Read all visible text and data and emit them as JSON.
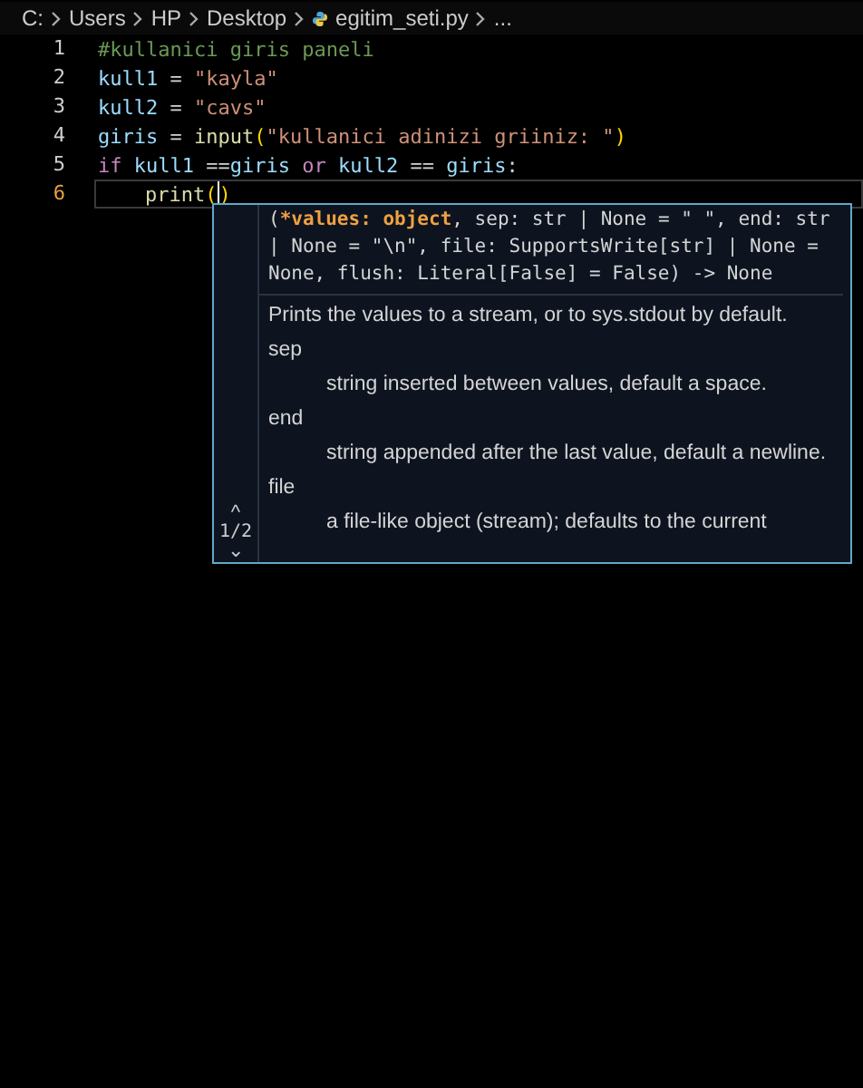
{
  "breadcrumb": [
    {
      "label": "C:",
      "kind": "text"
    },
    {
      "label": "Users",
      "kind": "text"
    },
    {
      "label": "HP",
      "kind": "text"
    },
    {
      "label": "Desktop",
      "kind": "text"
    },
    {
      "label": "egitim_seti.py",
      "kind": "file"
    },
    {
      "label": "...",
      "kind": "text"
    }
  ],
  "editor": {
    "lines": [
      {
        "number": "1",
        "current": false,
        "tokens": [
          {
            "text": "#kullanici giris paneli",
            "kind": "comment"
          }
        ]
      },
      {
        "number": "2",
        "current": false,
        "tokens": [
          {
            "text": "kull1",
            "kind": "variable"
          },
          {
            "text": " = ",
            "kind": "operator"
          },
          {
            "text": "\"kayla\"",
            "kind": "string"
          }
        ]
      },
      {
        "number": "3",
        "current": false,
        "tokens": [
          {
            "text": "kull2",
            "kind": "variable"
          },
          {
            "text": " = ",
            "kind": "operator"
          },
          {
            "text": "\"cavs\"",
            "kind": "string"
          }
        ]
      },
      {
        "number": "4",
        "current": false,
        "tokens": [
          {
            "text": "giris",
            "kind": "variable"
          },
          {
            "text": " = ",
            "kind": "operator"
          },
          {
            "text": "input",
            "kind": "function"
          },
          {
            "text": "(",
            "kind": "bracket"
          },
          {
            "text": "\"kullanici adinizi griiniz: \"",
            "kind": "string"
          },
          {
            "text": ")",
            "kind": "bracket"
          }
        ]
      },
      {
        "number": "5",
        "current": false,
        "tokens": [
          {
            "text": "if",
            "kind": "keyword"
          },
          {
            "text": " kull1",
            "kind": "variable"
          },
          {
            "text": " ==",
            "kind": "operator"
          },
          {
            "text": "giris",
            "kind": "variable"
          },
          {
            "text": " or",
            "kind": "keyword"
          },
          {
            "text": " kull2",
            "kind": "variable"
          },
          {
            "text": " == ",
            "kind": "operator"
          },
          {
            "text": "giris",
            "kind": "variable"
          },
          {
            "text": ":",
            "kind": "operator"
          }
        ]
      },
      {
        "number": "6",
        "current": true,
        "indented": true,
        "tokens": [
          {
            "text": "print",
            "kind": "function"
          },
          {
            "text": "(",
            "kind": "bracket"
          },
          {
            "text": ")",
            "kind": "bracket",
            "cursor_before": true
          }
        ]
      }
    ]
  },
  "signature_help": {
    "signature": [
      {
        "text": "(",
        "active": false
      },
      {
        "text": "*values: object",
        "active": true
      },
      {
        "text": ", sep: str | None = \" \", end: str | None = \"\\n\", file: SupportsWrite[str] | None = None, flush: Literal[False] = False) -> None",
        "active": false
      }
    ],
    "docs": [
      {
        "text": "Prints the values to a stream, or to sys.stdout by default.",
        "kind": "text"
      },
      {
        "text": "sep",
        "kind": "term"
      },
      {
        "text": "string inserted between values, default a space.",
        "kind": "desc"
      },
      {
        "text": "end",
        "kind": "term"
      },
      {
        "text": "string appended after the last value, default a newline.",
        "kind": "desc"
      },
      {
        "text": "file",
        "kind": "term"
      },
      {
        "text": "a file-like object (stream); defaults to the current",
        "kind": "desc"
      }
    ],
    "up_arrow": "^",
    "page": "1/2",
    "down_arrow": "⌄"
  }
}
